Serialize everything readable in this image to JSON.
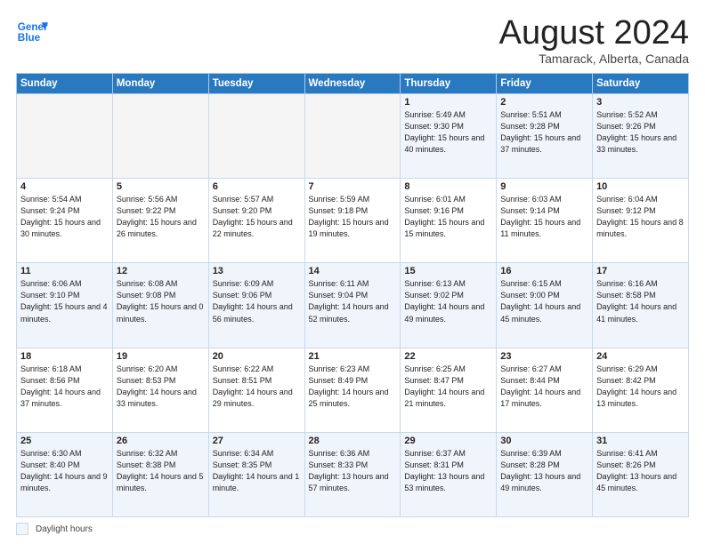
{
  "header": {
    "logo_line1": "General",
    "logo_line2": "Blue",
    "title": "August 2024",
    "location": "Tamarack, Alberta, Canada"
  },
  "weekdays": [
    "Sunday",
    "Monday",
    "Tuesday",
    "Wednesday",
    "Thursday",
    "Friday",
    "Saturday"
  ],
  "footer": {
    "legend_label": "Daylight hours"
  },
  "weeks": [
    [
      {
        "day": "",
        "info": ""
      },
      {
        "day": "",
        "info": ""
      },
      {
        "day": "",
        "info": ""
      },
      {
        "day": "",
        "info": ""
      },
      {
        "day": "1",
        "info": "Sunrise: 5:49 AM\nSunset: 9:30 PM\nDaylight: 15 hours\nand 40 minutes."
      },
      {
        "day": "2",
        "info": "Sunrise: 5:51 AM\nSunset: 9:28 PM\nDaylight: 15 hours\nand 37 minutes."
      },
      {
        "day": "3",
        "info": "Sunrise: 5:52 AM\nSunset: 9:26 PM\nDaylight: 15 hours\nand 33 minutes."
      }
    ],
    [
      {
        "day": "4",
        "info": "Sunrise: 5:54 AM\nSunset: 9:24 PM\nDaylight: 15 hours\nand 30 minutes."
      },
      {
        "day": "5",
        "info": "Sunrise: 5:56 AM\nSunset: 9:22 PM\nDaylight: 15 hours\nand 26 minutes."
      },
      {
        "day": "6",
        "info": "Sunrise: 5:57 AM\nSunset: 9:20 PM\nDaylight: 15 hours\nand 22 minutes."
      },
      {
        "day": "7",
        "info": "Sunrise: 5:59 AM\nSunset: 9:18 PM\nDaylight: 15 hours\nand 19 minutes."
      },
      {
        "day": "8",
        "info": "Sunrise: 6:01 AM\nSunset: 9:16 PM\nDaylight: 15 hours\nand 15 minutes."
      },
      {
        "day": "9",
        "info": "Sunrise: 6:03 AM\nSunset: 9:14 PM\nDaylight: 15 hours\nand 11 minutes."
      },
      {
        "day": "10",
        "info": "Sunrise: 6:04 AM\nSunset: 9:12 PM\nDaylight: 15 hours\nand 8 minutes."
      }
    ],
    [
      {
        "day": "11",
        "info": "Sunrise: 6:06 AM\nSunset: 9:10 PM\nDaylight: 15 hours\nand 4 minutes."
      },
      {
        "day": "12",
        "info": "Sunrise: 6:08 AM\nSunset: 9:08 PM\nDaylight: 15 hours\nand 0 minutes."
      },
      {
        "day": "13",
        "info": "Sunrise: 6:09 AM\nSunset: 9:06 PM\nDaylight: 14 hours\nand 56 minutes."
      },
      {
        "day": "14",
        "info": "Sunrise: 6:11 AM\nSunset: 9:04 PM\nDaylight: 14 hours\nand 52 minutes."
      },
      {
        "day": "15",
        "info": "Sunrise: 6:13 AM\nSunset: 9:02 PM\nDaylight: 14 hours\nand 49 minutes."
      },
      {
        "day": "16",
        "info": "Sunrise: 6:15 AM\nSunset: 9:00 PM\nDaylight: 14 hours\nand 45 minutes."
      },
      {
        "day": "17",
        "info": "Sunrise: 6:16 AM\nSunset: 8:58 PM\nDaylight: 14 hours\nand 41 minutes."
      }
    ],
    [
      {
        "day": "18",
        "info": "Sunrise: 6:18 AM\nSunset: 8:56 PM\nDaylight: 14 hours\nand 37 minutes."
      },
      {
        "day": "19",
        "info": "Sunrise: 6:20 AM\nSunset: 8:53 PM\nDaylight: 14 hours\nand 33 minutes."
      },
      {
        "day": "20",
        "info": "Sunrise: 6:22 AM\nSunset: 8:51 PM\nDaylight: 14 hours\nand 29 minutes."
      },
      {
        "day": "21",
        "info": "Sunrise: 6:23 AM\nSunset: 8:49 PM\nDaylight: 14 hours\nand 25 minutes."
      },
      {
        "day": "22",
        "info": "Sunrise: 6:25 AM\nSunset: 8:47 PM\nDaylight: 14 hours\nand 21 minutes."
      },
      {
        "day": "23",
        "info": "Sunrise: 6:27 AM\nSunset: 8:44 PM\nDaylight: 14 hours\nand 17 minutes."
      },
      {
        "day": "24",
        "info": "Sunrise: 6:29 AM\nSunset: 8:42 PM\nDaylight: 14 hours\nand 13 minutes."
      }
    ],
    [
      {
        "day": "25",
        "info": "Sunrise: 6:30 AM\nSunset: 8:40 PM\nDaylight: 14 hours\nand 9 minutes."
      },
      {
        "day": "26",
        "info": "Sunrise: 6:32 AM\nSunset: 8:38 PM\nDaylight: 14 hours\nand 5 minutes."
      },
      {
        "day": "27",
        "info": "Sunrise: 6:34 AM\nSunset: 8:35 PM\nDaylight: 14 hours\nand 1 minute."
      },
      {
        "day": "28",
        "info": "Sunrise: 6:36 AM\nSunset: 8:33 PM\nDaylight: 13 hours\nand 57 minutes."
      },
      {
        "day": "29",
        "info": "Sunrise: 6:37 AM\nSunset: 8:31 PM\nDaylight: 13 hours\nand 53 minutes."
      },
      {
        "day": "30",
        "info": "Sunrise: 6:39 AM\nSunset: 8:28 PM\nDaylight: 13 hours\nand 49 minutes."
      },
      {
        "day": "31",
        "info": "Sunrise: 6:41 AM\nSunset: 8:26 PM\nDaylight: 13 hours\nand 45 minutes."
      }
    ]
  ]
}
